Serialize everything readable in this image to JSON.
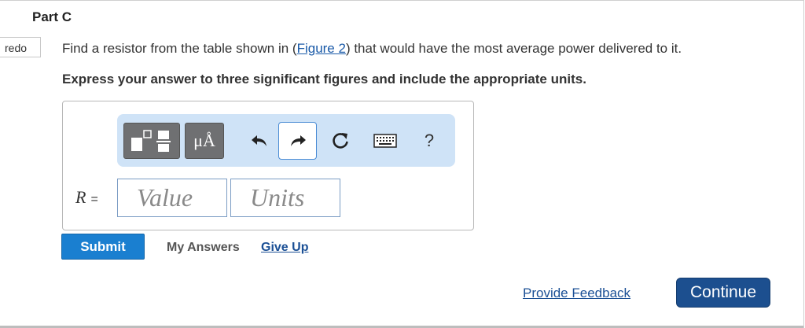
{
  "part": {
    "title": "Part C"
  },
  "tab": {
    "redo_label": "redo"
  },
  "question": {
    "text_before": "Find a resistor from the table shown in (",
    "link": "Figure 2",
    "text_after": ") that would have the most average power delivered to it.",
    "instruction": "Express your answer to three significant figures and include the appropriate units."
  },
  "toolbar": {
    "units_label": "μÅ",
    "help_label": "?",
    "icons": [
      "templates-icon",
      "units-icon",
      "undo-icon",
      "redo-icon",
      "reset-icon",
      "keyboard-icon",
      "help-icon"
    ]
  },
  "answer": {
    "variable": "R",
    "equals": "=",
    "value_placeholder": "Value",
    "units_placeholder": "Units"
  },
  "actions": {
    "submit": "Submit",
    "my_answers": "My Answers",
    "give_up": "Give Up"
  },
  "footer": {
    "feedback": "Provide Feedback",
    "continue": "Continue"
  },
  "colors": {
    "accent": "#1a7fd0",
    "toolbar_bg": "#cfe3f7",
    "continue_bg": "#1c4f8f",
    "link": "#1a4f95"
  }
}
